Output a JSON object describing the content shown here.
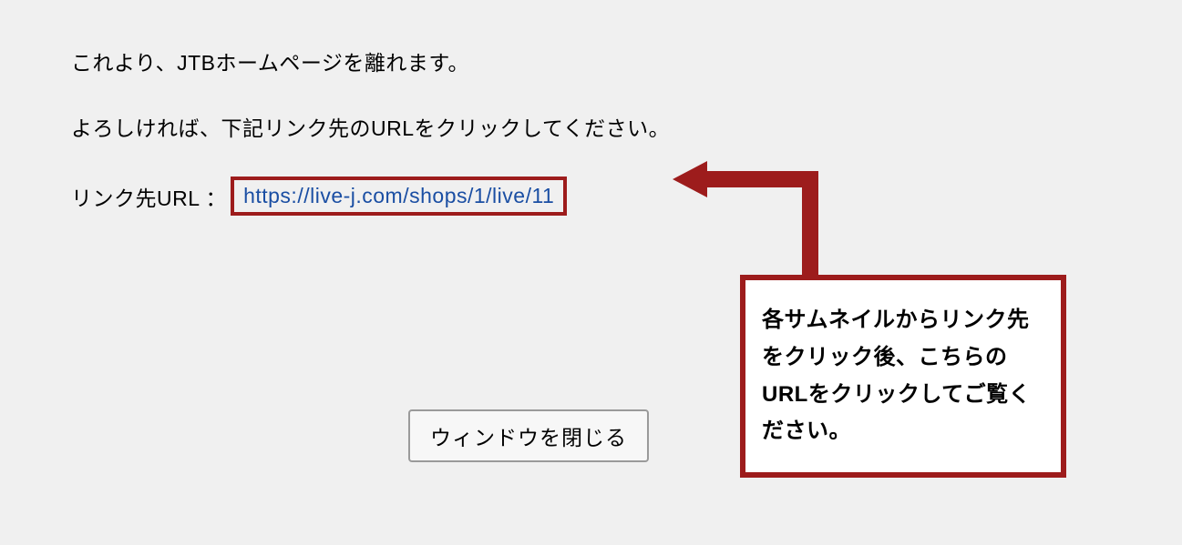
{
  "message_line1": "これより、JTBホームページを離れます。",
  "message_line2": "よろしければ、下記リンク先のURLをクリックしてください。",
  "url_label": "リンク先URL ：",
  "url_value": "https://live-j.com/shops/1/live/11",
  "close_button_label": "ウィンドウを閉じる",
  "callout_text": "各サムネイルからリンク先をクリック後、こちらのURLをクリックしてご覧ください。",
  "accent_color": "#9d1c1c",
  "link_color": "#1a4ea3"
}
